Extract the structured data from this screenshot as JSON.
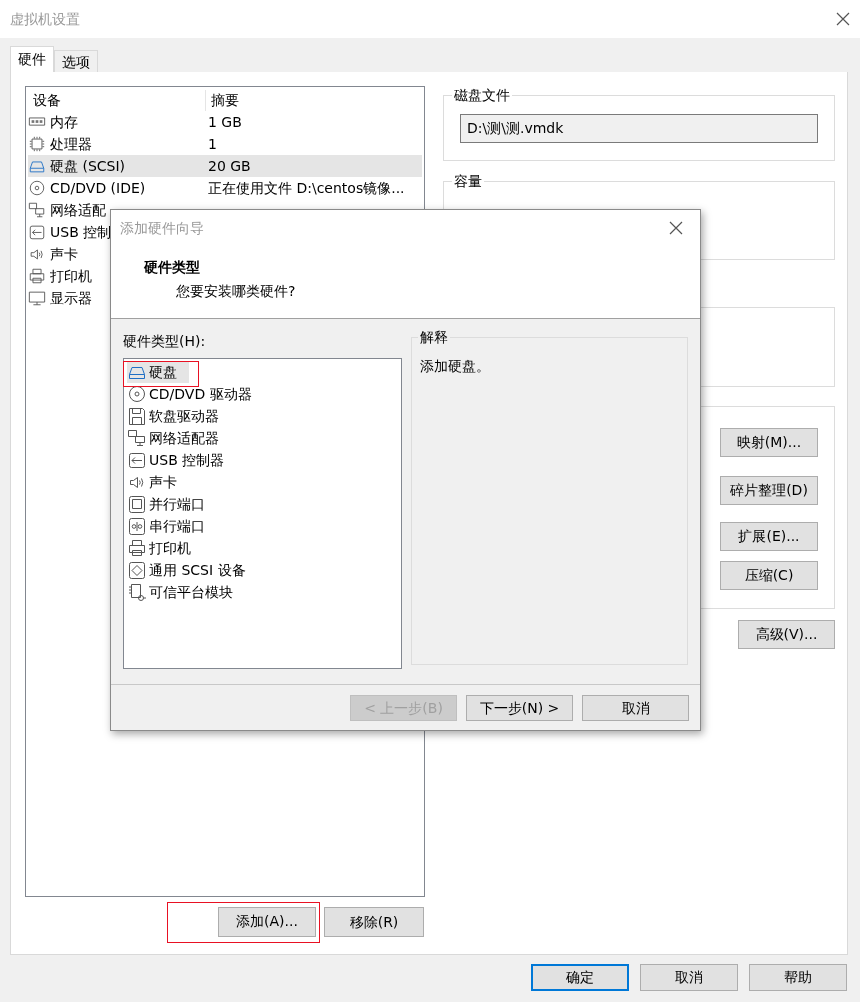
{
  "window": {
    "title": "虚拟机设置"
  },
  "tabs": [
    {
      "label": "硬件",
      "selected": true
    },
    {
      "label": "选项",
      "selected": false
    }
  ],
  "devices": {
    "columns": [
      "设备",
      "摘要"
    ],
    "rows": [
      {
        "kind": "memory",
        "name": "内存",
        "summary": "1 GB",
        "selected": false
      },
      {
        "kind": "cpu",
        "name": "处理器",
        "summary": "1",
        "selected": false
      },
      {
        "kind": "disk",
        "name": "硬盘 (SCSI)",
        "summary": "20 GB",
        "selected": true
      },
      {
        "kind": "cdrom",
        "name": "CD/DVD (IDE)",
        "summary": "正在使用文件 D:\\centos镜像...",
        "selected": false
      },
      {
        "kind": "network",
        "name": "网络适配",
        "selected": false
      },
      {
        "kind": "usb",
        "name": "USB 控制",
        "selected": false
      },
      {
        "kind": "sound",
        "name": "声卡",
        "selected": false
      },
      {
        "kind": "printer",
        "name": "打印机",
        "selected": false
      },
      {
        "kind": "display",
        "name": "显示器",
        "selected": false
      }
    ]
  },
  "device_buttons": [
    {
      "label": "添加(A)...",
      "highlighted": true
    },
    {
      "label": "移除(R)",
      "highlighted": false
    }
  ],
  "disk_file": {
    "title": "磁盘文件",
    "value": "D:\\测\\测.vmdk"
  },
  "capacity": {
    "title": "容量"
  },
  "disk_utilities": [
    "映射(M)...",
    "碎片整理(D)",
    "扩展(E)...",
    "压缩(C)"
  ],
  "advanced_button": "高级(V)...",
  "footer_buttons": [
    {
      "label": "确定",
      "default": true
    },
    {
      "label": "取消",
      "default": false
    },
    {
      "label": "帮助",
      "default": false
    }
  ],
  "wizard": {
    "title": "添加硬件向导",
    "heading": "硬件类型",
    "subtitle": "您要安装哪类硬件?",
    "list_label": "硬件类型(H):",
    "hardware_types": [
      {
        "kind": "disk",
        "label": "硬盘",
        "selected": true,
        "highlighted": true
      },
      {
        "kind": "cdrom",
        "label": "CD/DVD 驱动器",
        "selected": false,
        "highlighted": false
      },
      {
        "kind": "floppy",
        "label": "软盘驱动器",
        "selected": false,
        "highlighted": false
      },
      {
        "kind": "network",
        "label": "网络适配器",
        "selected": false,
        "highlighted": false
      },
      {
        "kind": "usb",
        "label": "USB 控制器",
        "selected": false,
        "highlighted": false
      },
      {
        "kind": "sound",
        "label": "声卡",
        "selected": false,
        "highlighted": false
      },
      {
        "kind": "parallel",
        "label": "并行端口",
        "selected": false,
        "highlighted": false
      },
      {
        "kind": "serial",
        "label": "串行端口",
        "selected": false,
        "highlighted": false
      },
      {
        "kind": "printer",
        "label": "打印机",
        "selected": false,
        "highlighted": false
      },
      {
        "kind": "scsi",
        "label": "通用 SCSI 设备",
        "selected": false,
        "highlighted": false
      },
      {
        "kind": "tpm",
        "label": "可信平台模块",
        "selected": false,
        "highlighted": false
      }
    ],
    "explanation": {
      "title": "解释",
      "text": "添加硬盘。"
    },
    "buttons": [
      {
        "label": "< 上一步(B)",
        "disabled": true
      },
      {
        "label": "下一步(N) >",
        "disabled": false
      },
      {
        "label": "取消",
        "disabled": false
      }
    ]
  }
}
